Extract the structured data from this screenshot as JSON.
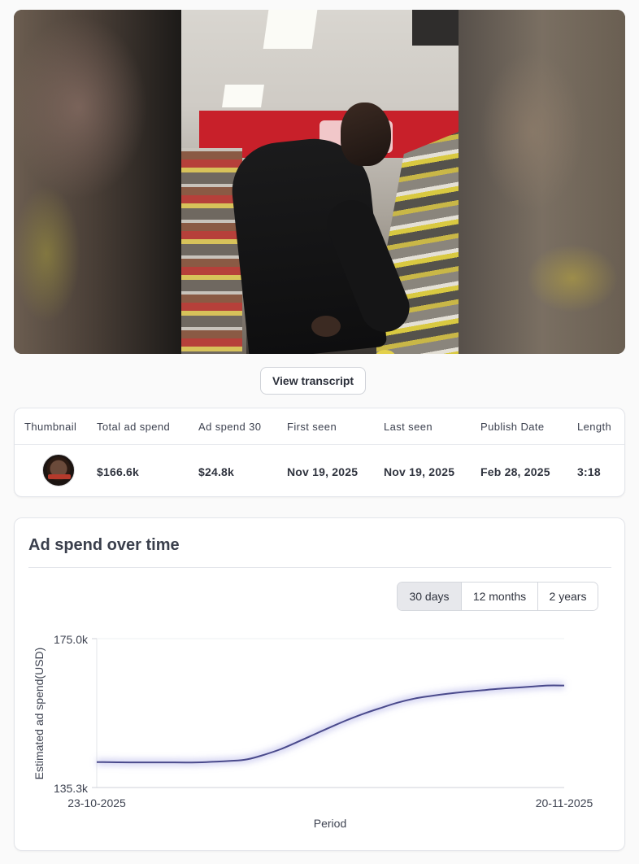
{
  "transcript_button": "View transcript",
  "stats": {
    "headers": [
      "Thumbnail",
      "Total ad spend",
      "Ad spend 30",
      "First seen",
      "Last seen",
      "Publish Date",
      "Length"
    ],
    "values": {
      "total_ad_spend": "$166.6k",
      "ad_spend_30": "$24.8k",
      "first_seen": "Nov 19, 2025",
      "last_seen": "Nov 19, 2025",
      "publish_date": "Feb 28, 2025",
      "length": "3:18"
    }
  },
  "chart_section": {
    "title": "Ad spend over time",
    "ranges": [
      "30 days",
      "12 months",
      "2 years"
    ],
    "active_range": "30 days"
  },
  "chart_data": {
    "type": "line",
    "title": "",
    "xlabel": "Period",
    "ylabel": "Estimated ad spend(USD)",
    "ylim": [
      135300,
      175000
    ],
    "y_ticks": [
      "175.0k",
      "135.3k"
    ],
    "x_tick_labels": [
      "23-10-2025",
      "20-11-2025"
    ],
    "x_range_days": [
      0,
      28
    ],
    "series": [
      {
        "color": "#4a4a8c",
        "x": [
          0,
          2,
          4,
          6,
          8,
          9,
          10,
          11,
          12,
          13,
          14,
          15,
          16,
          17,
          18,
          19,
          20,
          21,
          22,
          23,
          24,
          25,
          26,
          27,
          28
        ],
        "y": [
          142100,
          142000,
          142000,
          142000,
          142400,
          142800,
          144000,
          145500,
          147400,
          149400,
          151400,
          153300,
          155000,
          156500,
          157900,
          159000,
          159700,
          160300,
          160800,
          161200,
          161600,
          161900,
          162200,
          162500,
          162500
        ]
      }
    ],
    "grid": false,
    "legend": "none"
  },
  "colors": {
    "accent_line": "#4a4a8c",
    "card_border": "#e3e5ea",
    "active_range_bg": "#e7e8ec"
  }
}
